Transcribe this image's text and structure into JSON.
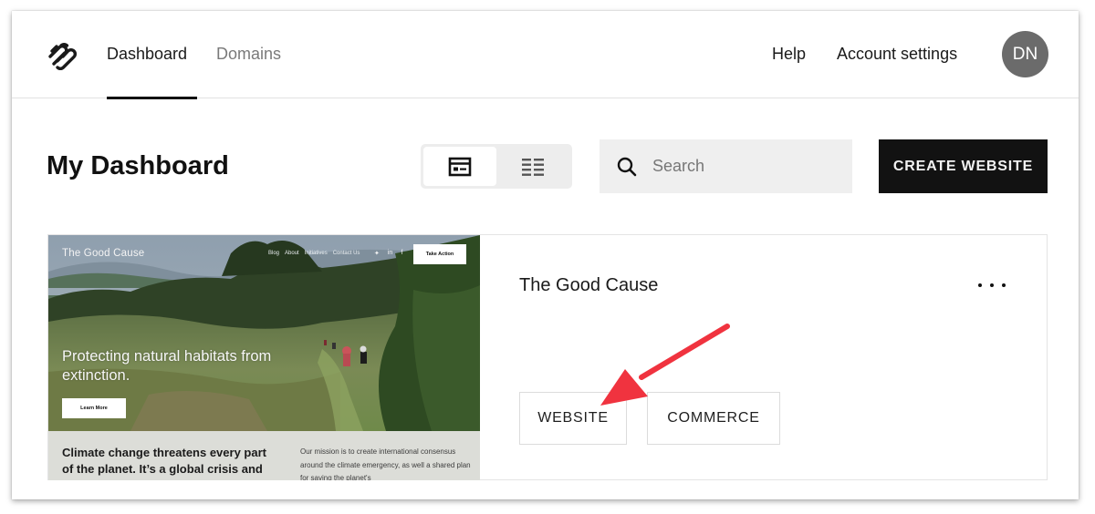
{
  "nav": {
    "logo": "squarespace-logo-icon",
    "tabs": [
      {
        "label": "Dashboard",
        "active": true
      },
      {
        "label": "Domains",
        "active": false
      }
    ],
    "help_label": "Help",
    "account_label": "Account settings",
    "avatar_initials": "DN"
  },
  "toolbar": {
    "page_title": "My Dashboard",
    "view_toggle": [
      {
        "icon": "grid-view-icon",
        "active": true
      },
      {
        "icon": "list-view-icon",
        "active": false
      }
    ],
    "search_placeholder": "Search",
    "search_value": "",
    "create_label": "CREATE WEBSITE"
  },
  "site_card": {
    "name": "The Good Cause",
    "more_icon": "more-horizontal-icon",
    "actions": [
      {
        "label": "WEBSITE"
      },
      {
        "label": "COMMERCE"
      }
    ],
    "thumbnail": {
      "brand": "The Good Cause",
      "nav_links": [
        "Blog",
        "About",
        "Initiatives",
        "Contact Us"
      ],
      "social_icons": [
        "twitter-icon",
        "linkedin-icon",
        "facebook-icon"
      ],
      "social_glyphs": [
        "✦",
        "in",
        "f"
      ],
      "cta": "Take Action",
      "headline": "Protecting natural habitats from extinction.",
      "learn_more": "Learn More",
      "lead_text": "Climate change threatens every part of the planet. It’s a global crisis and a concern for each of us.",
      "body_text": "Our mission is to create international consensus around the climate emergency, as well a shared plan for saving the planet's"
    }
  },
  "annotation": {
    "arrow_color": "#f0333f",
    "target": "WEBSITE"
  }
}
